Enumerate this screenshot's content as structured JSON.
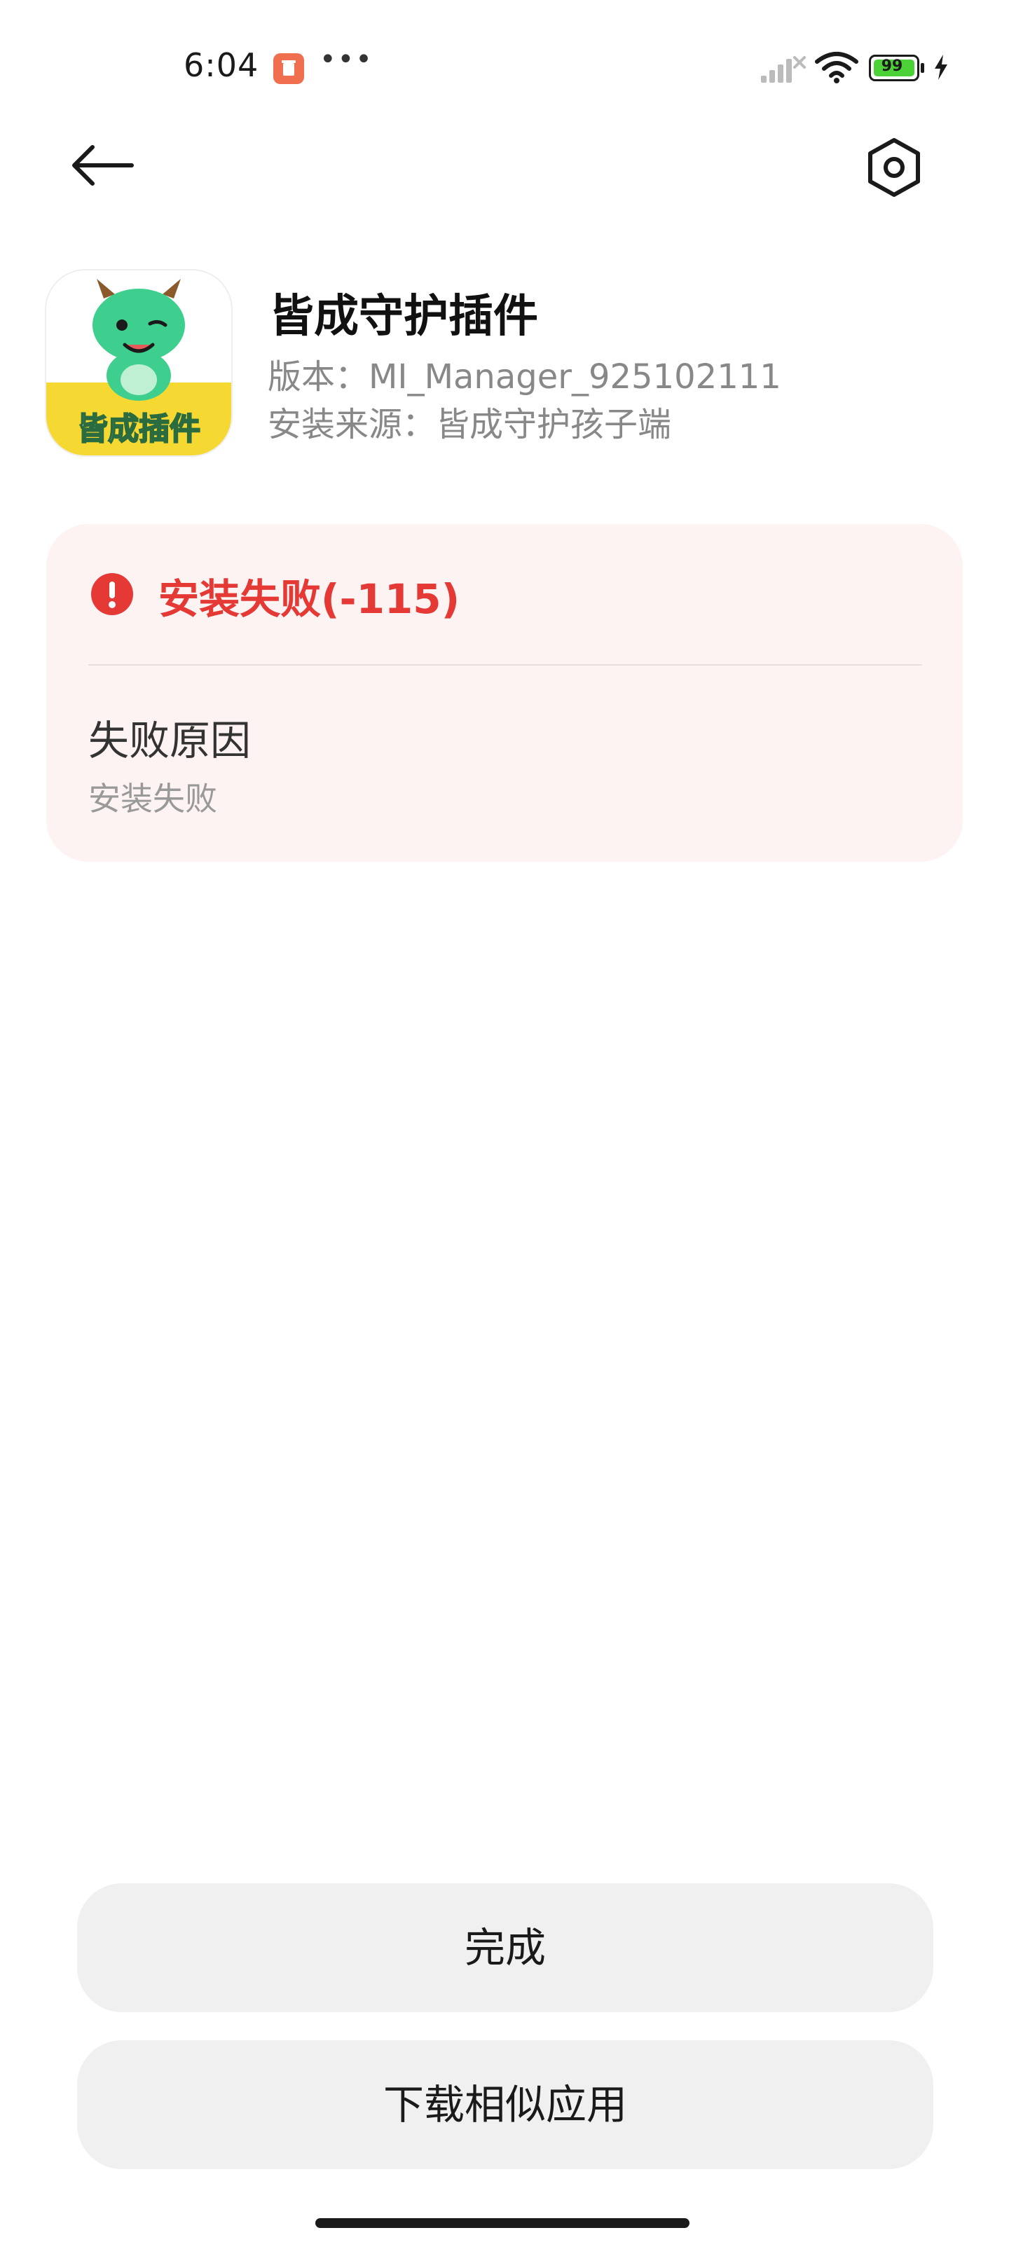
{
  "status_bar": {
    "time": "6:04",
    "battery_level": "99",
    "battery_color": "#4cd137",
    "icons": [
      "notification-app-icon",
      "more-dots-icon",
      "signal-icon",
      "wifi-icon",
      "battery-icon",
      "charging-icon"
    ]
  },
  "nav": {
    "back_icon": "arrow-left-icon",
    "settings_icon": "hexagon-gear-icon"
  },
  "app": {
    "icon_label": "皆成插件",
    "name": "皆成守护插件",
    "version": "版本：MI_Manager_925102111",
    "source": "安装来源：皆成守护孩子端"
  },
  "error": {
    "title": "安装失败(-115)",
    "reason_label": "失败原因",
    "reason": "安装失败",
    "accent_color": "#e53935"
  },
  "actions": {
    "done_label": "完成",
    "similar_label": "下载相似应用"
  }
}
